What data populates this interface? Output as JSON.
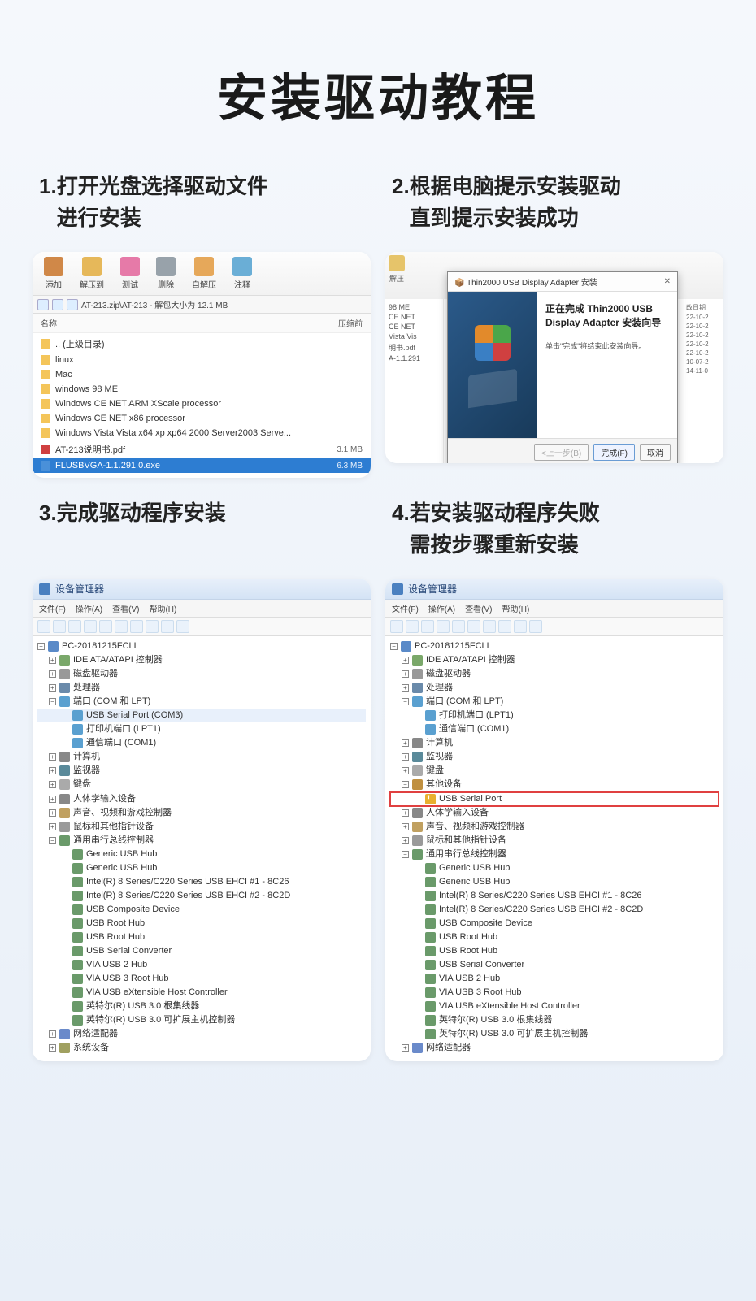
{
  "page_title": "安装驱动教程",
  "steps": {
    "s1": {
      "num": "1.",
      "line1": "打开光盘选择驱动文件",
      "line2": "进行安装"
    },
    "s2": {
      "num": "2.",
      "line1": "根据电脑提示安装驱动",
      "line2": "直到提示安装成功"
    },
    "s3": {
      "num": "3.",
      "line1": "完成驱动程序安装",
      "line2": ""
    },
    "s4": {
      "num": "4.",
      "line1": "若安装驱动程序失败",
      "line2": "需按步骤重新安装"
    }
  },
  "archive": {
    "toolbar": [
      "添加",
      "解压到",
      "测试",
      "删除",
      "自解压",
      "注释"
    ],
    "address": "AT-213.zip\\AT-213 - 解包大小为 12.1 MB",
    "col_name": "名称",
    "col_size": "压缩前",
    "files": [
      {
        "name": ".. (上级目录)",
        "size": "",
        "ico": ""
      },
      {
        "name": "linux",
        "size": "",
        "ico": ""
      },
      {
        "name": "Mac",
        "size": "",
        "ico": ""
      },
      {
        "name": "windows 98 ME",
        "size": "",
        "ico": ""
      },
      {
        "name": "Windows CE NET ARM XScale processor",
        "size": "",
        "ico": ""
      },
      {
        "name": "Windows CE NET x86 processor",
        "size": "",
        "ico": ""
      },
      {
        "name": "Windows Vista Vista x64 xp xp64 2000 Server2003 Serve...",
        "size": "",
        "ico": ""
      },
      {
        "name": "AT-213说明书.pdf",
        "size": "3.1 MB",
        "ico": "pdf"
      },
      {
        "name": "FLUSBVGA-1.1.291.0.exe",
        "size": "6.3 MB",
        "ico": "exe",
        "sel": true
      }
    ]
  },
  "installer": {
    "bg_toolbar_label": "解压",
    "window_title": "Thin2000 USB Display Adapter 安装",
    "title": "正在完成 Thin2000 USB Display Adapter 安装向导",
    "subtitle": "单击\"完成\"将结束此安装向导。",
    "btn_back": "<上一步(B)",
    "btn_finish": "完成(F)",
    "btn_cancel": "取消",
    "bg_files": [
      "98 ME",
      "CE NET",
      "CE NET",
      "Vista Vis",
      "明书.pdf",
      "A-1.1.291"
    ],
    "bg_dates": [
      "改日期",
      "22-10-2",
      "22-10-2",
      "22-10-2",
      "22-10-2",
      "22-10-2",
      "10-07-2",
      "14-11-0"
    ]
  },
  "devmgr": {
    "title": "设备管理器",
    "menu": {
      "file": "文件(F)",
      "action": "操作(A)",
      "view": "查看(V)",
      "help": "帮助(H)"
    },
    "root": "PC-20181215FCLL",
    "nodes": {
      "ide": "IDE ATA/ATAPI 控制器",
      "disk": "磁盘驱动器",
      "cpu": "处理器",
      "ports": "端口 (COM 和 LPT)",
      "usbserial": "USB Serial Port (COM3)",
      "usbserial_noport": "USB Serial Port",
      "printerport": "打印机端口 (LPT1)",
      "comport": "通信端口 (COM1)",
      "computer": "计算机",
      "monitor": "监视器",
      "keyboard": "键盘",
      "other": "其他设备",
      "hid": "人体学输入设备",
      "sound": "声音、视频和游戏控制器",
      "mouse": "鼠标和其他指针设备",
      "usbctrl": "通用串行总线控制器",
      "usb": [
        "Generic USB Hub",
        "Generic USB Hub",
        "Intel(R) 8 Series/C220 Series USB EHCI #1 - 8C26",
        "Intel(R) 8 Series/C220 Series USB EHCI #2 - 8C2D",
        "USB Composite Device",
        "USB Root Hub",
        "USB Root Hub",
        "USB Serial Converter",
        "VIA USB 2 Hub",
        "VIA USB 3 Root Hub",
        "VIA USB eXtensible Host Controller",
        "英特尔(R) USB 3.0 根集线器",
        "英特尔(R) USB 3.0 可扩展主机控制器"
      ],
      "network": "网络适配器",
      "system": "系统设备"
    }
  }
}
